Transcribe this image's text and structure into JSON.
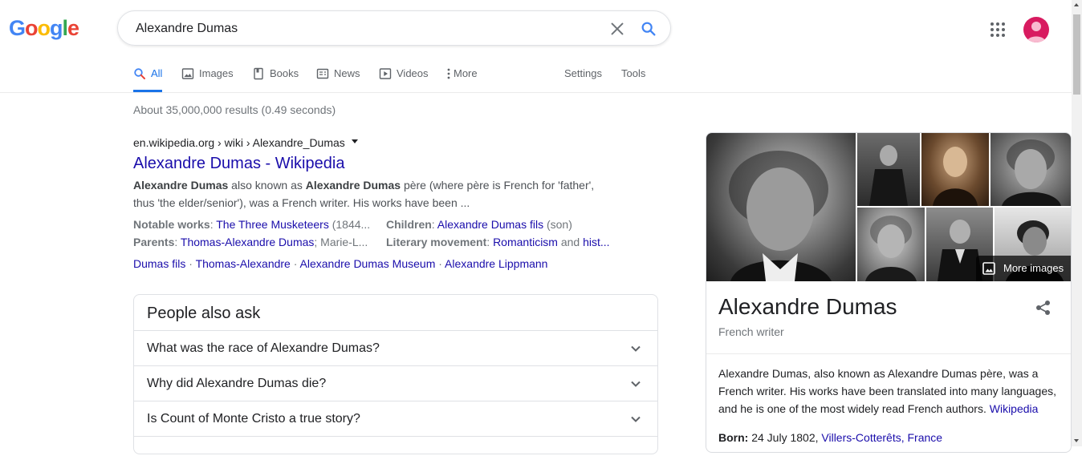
{
  "logo": {
    "g1": "G",
    "o1": "o",
    "o2": "o",
    "g2": "g",
    "l": "l",
    "e": "e"
  },
  "search": {
    "query": "Alexandre Dumas",
    "placeholder": ""
  },
  "tabs": [
    {
      "label": "All",
      "icon": "search-icon",
      "active": true
    },
    {
      "label": "Images",
      "icon": "image-icon"
    },
    {
      "label": "Books",
      "icon": "book-icon"
    },
    {
      "label": "News",
      "icon": "news-icon"
    },
    {
      "label": "Videos",
      "icon": "play-icon"
    },
    {
      "label": "More",
      "icon": "more-vert-icon"
    }
  ],
  "tools": {
    "settings": "Settings",
    "tools": "Tools"
  },
  "stats": "About 35,000,000 results (0.49 seconds)",
  "result": {
    "url": "en.wikipedia.org › wiki › Alexandre_Dumas",
    "title": "Alexandre Dumas - Wikipedia",
    "snippet": {
      "b1": "Alexandre Dumas",
      "t1": " also known as ",
      "b2": "Alexandre Dumas",
      "t2": " père (where père is French for 'father', thus 'the elder/senior'), was a French writer. His works have been ..."
    },
    "facts": {
      "notable_key": "Notable works",
      "notable_val": "The Three Musketeers",
      "notable_tail": " (1844...",
      "children_key": "Children",
      "children_val": "Alexandre Dumas fils",
      "children_tail": " (son)",
      "parents_key": "Parents",
      "parents_val": "Thomas-Alexandre Dumas",
      "parents_tail": "; Marie-L...",
      "movement_key": "Literary movement",
      "movement_val": "Romanticism",
      "movement_mid": " and ",
      "movement_val2": "hist..."
    },
    "sitelinks": [
      "Dumas fils",
      "Thomas-Alexandre",
      "Alexandre Dumas Museum",
      "Alexandre Lippmann"
    ],
    "sitelink_sep": " · "
  },
  "paa": {
    "title": "People also ask",
    "questions": [
      "What was the race of Alexandre Dumas?",
      "Why did Alexandre Dumas die?",
      "Is Count of Monte Cristo a true story?"
    ]
  },
  "knowledge_panel": {
    "more_images": "More images",
    "title": "Alexandre Dumas",
    "subtitle": "French writer",
    "description": "Alexandre Dumas, also known as Alexandre Dumas père, was a French writer. His works have been translated into many languages, and he is one of the most widely read French authors.",
    "source": "Wikipedia",
    "born_key": "Born:",
    "born_date": " 24 July 1802, ",
    "born_place": "Villers-Cotterêts, France"
  },
  "colors": {
    "link": "#1a0dab",
    "accent": "#1a73e8",
    "avatar": "#d81b60"
  }
}
